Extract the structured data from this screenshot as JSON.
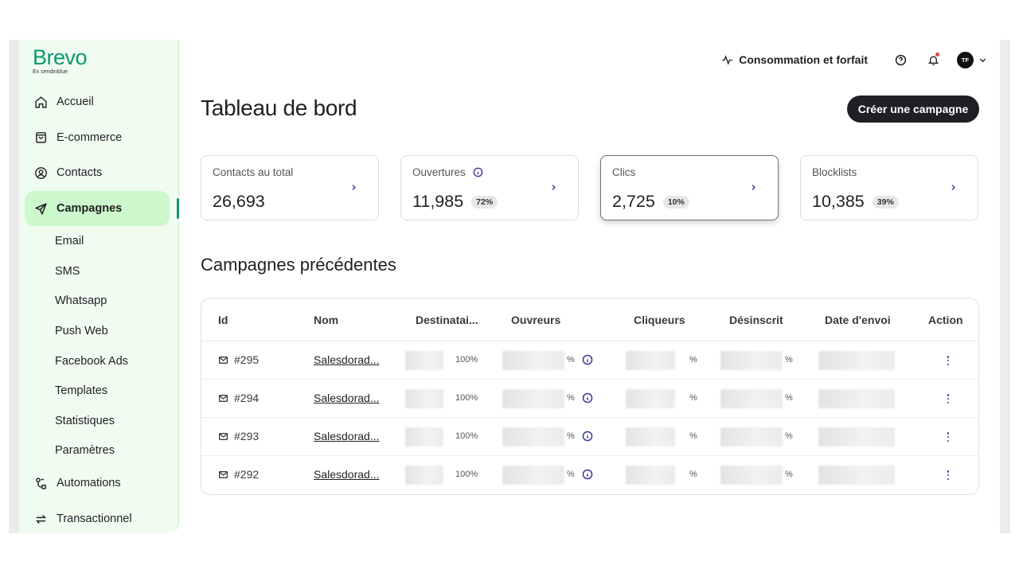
{
  "brand": {
    "name": "Brevo",
    "tagline": "Ex sendinblue",
    "color": "#0b996e"
  },
  "sidebar": {
    "items": [
      {
        "label": "Accueil",
        "icon": "home-icon"
      },
      {
        "label": "E-commerce",
        "icon": "shopping-bag-icon"
      },
      {
        "label": "Contacts",
        "icon": "contact-icon"
      },
      {
        "label": "Campagnes",
        "icon": "send-icon",
        "active": true
      }
    ],
    "sub_items": [
      "Email",
      "SMS",
      "Whatsapp",
      "Push Web",
      "Facebook Ads",
      "Templates",
      "Statistiques",
      "Paramètres"
    ],
    "bottom_items": [
      {
        "label": "Automations",
        "icon": "automation-icon"
      },
      {
        "label": "Transactionnel",
        "icon": "arrows-icon"
      }
    ]
  },
  "header": {
    "consumption_label": "Consommation et forfait",
    "avatar_initials": "TF"
  },
  "page": {
    "title": "Tableau de bord",
    "create_button": "Créer une campagne"
  },
  "stats": [
    {
      "label": "Contacts au total",
      "value": "26,693",
      "pct": ""
    },
    {
      "label": "Ouvertures",
      "value": "11,985",
      "pct": "72%"
    },
    {
      "label": "Clics",
      "value": "2,725",
      "pct": "10%"
    },
    {
      "label": "Blocklists",
      "value": "10,385",
      "pct": "39%"
    }
  ],
  "campaigns": {
    "title": "Campagnes précédentes",
    "columns": [
      "Id",
      "Nom",
      "Destinatai...",
      "Ouvreurs",
      "Cliqueurs",
      "Désinscrit",
      "Date d'envoi",
      "Action"
    ],
    "rows": [
      {
        "id": "#295",
        "name": "Salesdorad...",
        "dest_pct": "100%",
        "open_pct": "%",
        "click_pct": "%",
        "unsub_pct": "%"
      },
      {
        "id": "#294",
        "name": "Salesdorad...",
        "dest_pct": "100%",
        "open_pct": "%",
        "click_pct": "%",
        "unsub_pct": "%"
      },
      {
        "id": "#293",
        "name": "Salesdorad...",
        "dest_pct": "100%",
        "open_pct": "%",
        "click_pct": "%",
        "unsub_pct": "%"
      },
      {
        "id": "#292",
        "name": "Salesdorad...",
        "dest_pct": "100%",
        "open_pct": "%",
        "click_pct": "%",
        "unsub_pct": "%"
      }
    ]
  }
}
